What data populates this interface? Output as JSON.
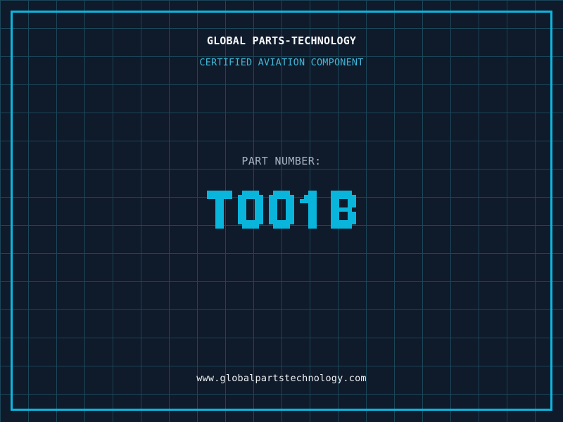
{
  "page": {
    "title": "GLOBAL PARTS-TECHNOLOGY",
    "subtitle": "CERTIFIED AVIATION COMPONENT",
    "part_number_label": "PART NUMBER:",
    "part_number": "T001B",
    "website": "www.globalpartstechnology.com"
  },
  "colors": {
    "background": "#0f1a2a",
    "grid_line": "#1b4759",
    "frame": "#0cb7e0",
    "title": "#f4f6f8",
    "subtitle": "#41b7d7",
    "part_number_label": "#a9b4c3",
    "part_number": "#0ab5dc",
    "website": "#eef1f4"
  }
}
